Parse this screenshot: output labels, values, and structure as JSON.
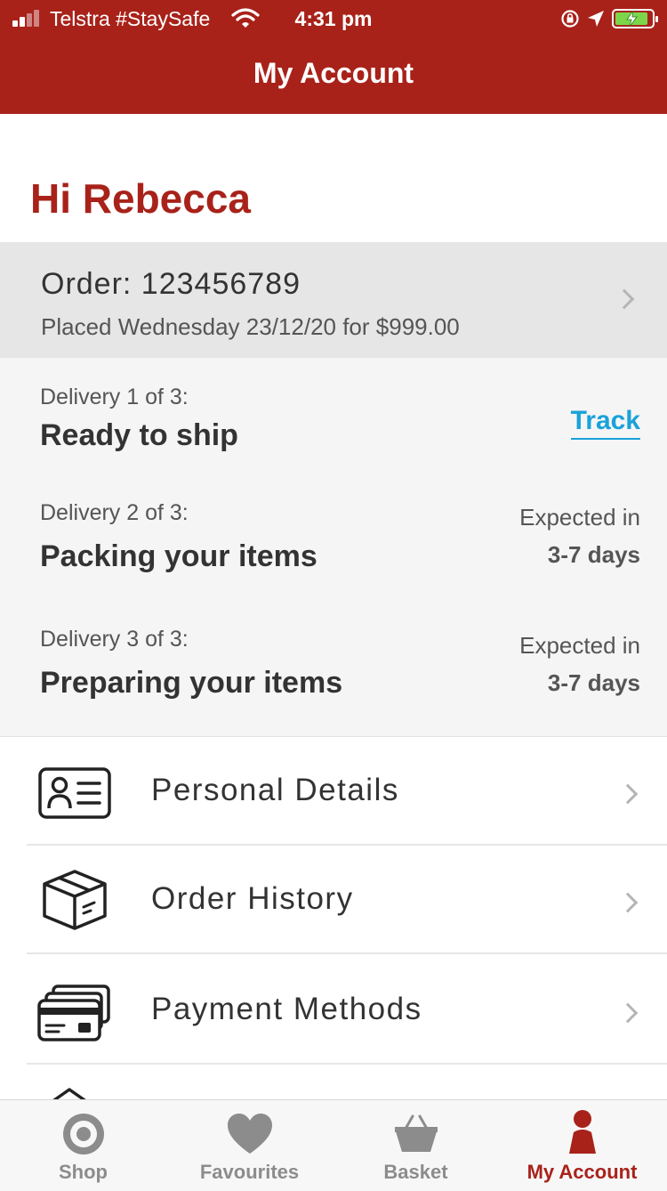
{
  "status_bar": {
    "carrier": "Telstra #StaySafe",
    "time": "4:31 pm"
  },
  "header": {
    "title": "My Account"
  },
  "greeting": "Hi Rebecca",
  "order": {
    "title": "Order: 123456789",
    "subtitle": "Placed Wednesday 23/12/20 for $999.00"
  },
  "deliveries": [
    {
      "label": "Delivery 1 of 3:",
      "status": "Ready to ship",
      "action": "Track"
    },
    {
      "label": "Delivery 2 of 3:",
      "status": "Packing your items",
      "expected_label": "Expected in",
      "expected_value": "3-7 days"
    },
    {
      "label": "Delivery 3 of 3:",
      "status": "Preparing your items",
      "expected_label": "Expected in",
      "expected_value": "3-7 days"
    }
  ],
  "menu": [
    {
      "label": "Personal Details",
      "icon": "id-card-icon"
    },
    {
      "label": "Order History",
      "icon": "box-icon"
    },
    {
      "label": "Payment Methods",
      "icon": "credit-cards-icon"
    }
  ],
  "tabs": [
    {
      "label": "Shop",
      "icon": "target-icon"
    },
    {
      "label": "Favourites",
      "icon": "heart-icon"
    },
    {
      "label": "Basket",
      "icon": "basket-icon"
    },
    {
      "label": "My Account",
      "icon": "person-icon",
      "active": true
    }
  ],
  "colors": {
    "brand": "#a8221a",
    "link": "#1aa2d9",
    "inactive_tab": "#8c8c8c"
  }
}
